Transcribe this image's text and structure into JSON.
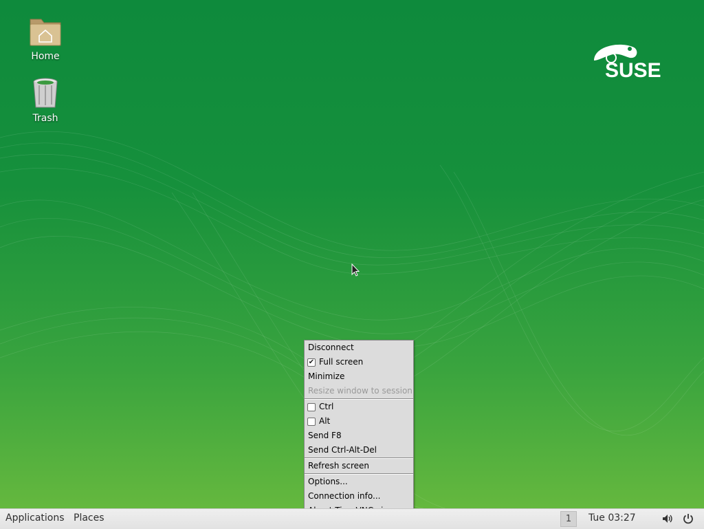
{
  "desktop": {
    "icons": [
      {
        "label": "Home",
        "icon": "home-folder-icon"
      },
      {
        "label": "Trash",
        "icon": "trash-icon"
      }
    ],
    "logo_text": "SUSE",
    "background_color": "#16903c"
  },
  "vnc_menu": {
    "items": [
      {
        "label": "Disconnect"
      },
      {
        "label": "Full screen",
        "checkbox": true,
        "checked": true
      },
      {
        "label": "Minimize"
      },
      {
        "label": "Resize window to session",
        "disabled": true
      },
      {
        "label": "Ctrl",
        "checkbox": true,
        "checked": false
      },
      {
        "label": "Alt",
        "checkbox": true,
        "checked": false
      },
      {
        "label": "Send F8"
      },
      {
        "label": "Send Ctrl-Alt-Del"
      },
      {
        "label": "Refresh screen"
      },
      {
        "label": "Options..."
      },
      {
        "label": "Connection info..."
      },
      {
        "label": "About TigerVNC viewer..."
      }
    ]
  },
  "panel": {
    "applications_label": "Applications",
    "places_label": "Places",
    "workspace_number": "1",
    "clock": "Tue 03:27",
    "tray_icons": [
      "volume-icon",
      "power-icon"
    ]
  }
}
